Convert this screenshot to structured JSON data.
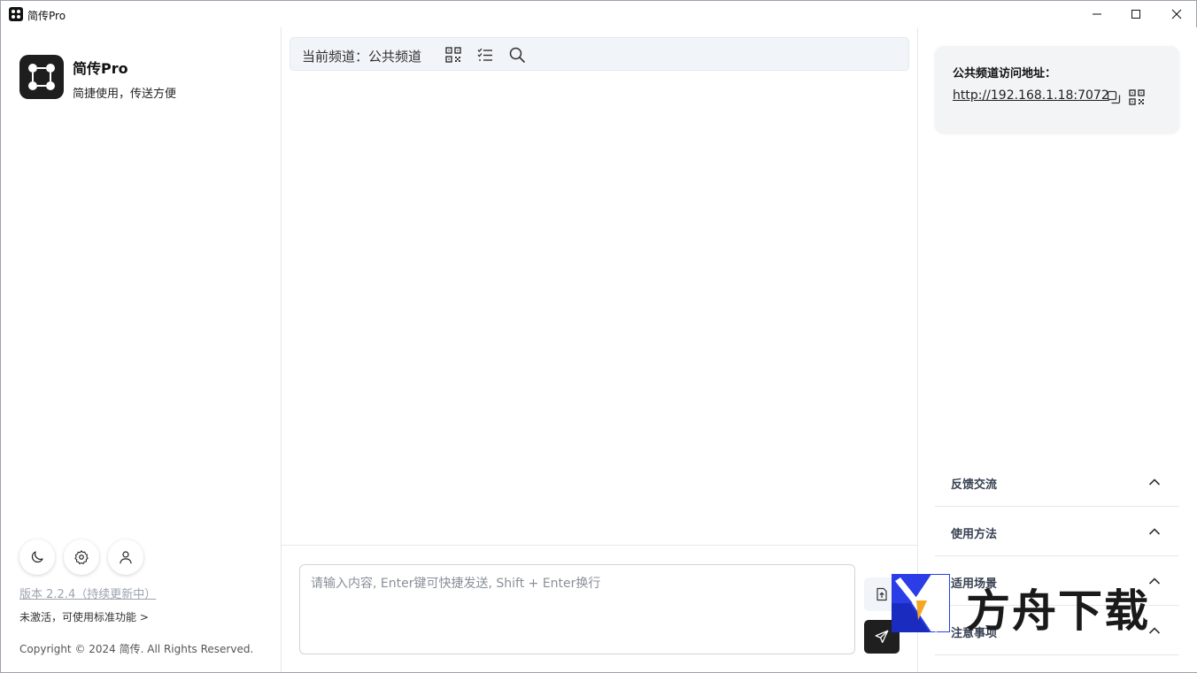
{
  "window": {
    "title": "简传Pro"
  },
  "sidebar": {
    "app_name": "简传Pro",
    "tagline": "简捷使用，传送方便",
    "version_text": "版本 2.2.4（持续更新中）",
    "activation_text": "未激活，可使用标准功能 >",
    "copyright": "Copyright © 2024 简传. All Rights Reserved.",
    "buttons": [
      {
        "icon": "moon-icon"
      },
      {
        "icon": "gear-icon"
      },
      {
        "icon": "user-icon"
      }
    ]
  },
  "center": {
    "channel_label": "当前频道：公共频道",
    "channel_icons": [
      "qr-code-icon",
      "list-icon",
      "search-icon"
    ],
    "input_placeholder": "请输入内容, Enter键可快捷发送, Shift + Enter换行"
  },
  "right": {
    "access_title": "公共频道访问地址：",
    "access_url": "http://192.168.1.18:7072",
    "accordion": [
      {
        "label": "反馈交流"
      },
      {
        "label": "使用方法"
      },
      {
        "label": "适用场景"
      },
      {
        "label": "注意事项"
      }
    ]
  },
  "watermark": {
    "text": "方舟下载"
  },
  "colors": {
    "accent_dark": "#1f1f1f",
    "bar_bg": "#f1f4f8",
    "card_bg": "#f3f4f6",
    "watermark_blue": "#2b3de6",
    "watermark_orange": "#f5a623"
  }
}
